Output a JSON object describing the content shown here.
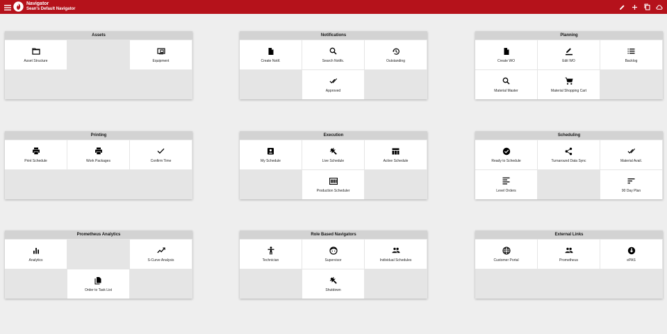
{
  "header": {
    "app_title": "Navigator",
    "sub_title": "Sean's Default Navigator"
  },
  "colors": {
    "brand": "#b5121b",
    "page_bg": "#eeeeee",
    "card_header": "#d3d3d3"
  },
  "cards": {
    "assets": {
      "title": "Assets",
      "tiles": [
        {
          "label": "Asset Structure",
          "icon": "folder-icon"
        },
        {
          "label": "Equipment",
          "icon": "equipment-icon"
        }
      ]
    },
    "notifications": {
      "title": "Notifications",
      "tiles": [
        {
          "label": "Create Notif.",
          "icon": "file-icon"
        },
        {
          "label": "Search Notifs.",
          "icon": "search-icon"
        },
        {
          "label": "Outstanding",
          "icon": "history-icon"
        },
        {
          "label": "Approved",
          "icon": "double-check-icon"
        }
      ]
    },
    "planning": {
      "title": "Planning",
      "tiles": [
        {
          "label": "Create WO",
          "icon": "file-icon"
        },
        {
          "label": "Edit WO",
          "icon": "edit-icon"
        },
        {
          "label": "Backlog",
          "icon": "list-icon"
        },
        {
          "label": "Material Master",
          "icon": "search-icon"
        },
        {
          "label": "Material Shopping Cart",
          "icon": "cart-icon"
        }
      ]
    },
    "printing": {
      "title": "Printing",
      "tiles": [
        {
          "label": "Print Schedule",
          "icon": "printer-icon"
        },
        {
          "label": "Work Packages",
          "icon": "printer-icon"
        },
        {
          "label": "Confirm Time",
          "icon": "check-icon"
        }
      ]
    },
    "execution": {
      "title": "Execution",
      "tiles": [
        {
          "label": "My Schedule",
          "icon": "contact-icon"
        },
        {
          "label": "Live Schedule",
          "icon": "wrench-icon"
        },
        {
          "label": "Active Schedule",
          "icon": "table-icon"
        },
        {
          "label": "Production Scheduler",
          "icon": "calendar-view-icon"
        }
      ]
    },
    "scheduling": {
      "title": "Scheduling",
      "tiles": [
        {
          "label": "Ready to Schedule",
          "icon": "check-circle-icon"
        },
        {
          "label": "Turnaround Data Sync",
          "icon": "share-icon"
        },
        {
          "label": "Material Avail.",
          "icon": "double-check-icon"
        },
        {
          "label": "Level Orders",
          "icon": "align-icon"
        },
        {
          "label": "90 Day Plan",
          "icon": "sort-icon"
        }
      ]
    },
    "analytics": {
      "title": "Prometheus Analytics",
      "tiles": [
        {
          "label": "Analytics",
          "icon": "bar-chart-icon"
        },
        {
          "label": "S-Curve Analysis",
          "icon": "trend-icon"
        },
        {
          "label": "Order to Task List",
          "icon": "copy-file-icon"
        }
      ]
    },
    "roles": {
      "title": "Role Based Navigators",
      "tiles": [
        {
          "label": "Technician",
          "icon": "person-icon"
        },
        {
          "label": "Supervisor",
          "icon": "face-icon"
        },
        {
          "label": "Individual Schedules",
          "icon": "people-icon"
        },
        {
          "label": "Shutdown",
          "icon": "wrench-icon"
        }
      ]
    },
    "external": {
      "title": "External Links",
      "tiles": [
        {
          "label": "Customer Portal",
          "icon": "globe-icon"
        },
        {
          "label": "Prometheus",
          "icon": "people-icon"
        },
        {
          "label": "ePAS",
          "icon": "download-circle-icon"
        }
      ]
    }
  }
}
